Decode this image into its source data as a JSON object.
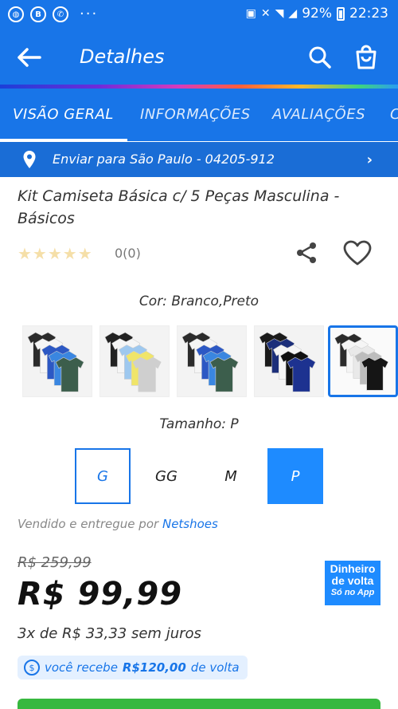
{
  "status_bar": {
    "left_icons": [
      "notification-icon",
      "b-icon",
      "whatsapp-icon"
    ],
    "more": "···",
    "battery_pct": "92%",
    "time": "22:23"
  },
  "app_bar": {
    "title": "Detalhes"
  },
  "tabs": [
    {
      "label": "VISÃO GERAL",
      "active": true
    },
    {
      "label": "INFORMAÇÕES",
      "active": false
    },
    {
      "label": "AVALIAÇÕES",
      "active": false
    },
    {
      "label": "C",
      "active": false
    }
  ],
  "shipping": {
    "text": "Enviar para São Paulo - 04205-912"
  },
  "product": {
    "title": "Kit Camiseta Básica c/ 5 Peças Masculina - Básicos",
    "stars": "★★★★★",
    "rating_count": "0(0)",
    "rating_value": 0
  },
  "color": {
    "label": "Cor: Branco,Preto",
    "swatches": [
      {
        "name": "kit-green-blue",
        "selected": false,
        "shirts": [
          "#2b2b2b",
          "#f5f5f5",
          "#2c58c4",
          "#3a86e0",
          "#3c5e4c"
        ]
      },
      {
        "name": "kit-grey-yellow",
        "selected": false,
        "shirts": [
          "#222222",
          "#f5f5f5",
          "#9ec8ef",
          "#f0e56a",
          "#cfcfcf"
        ]
      },
      {
        "name": "kit-green-navy",
        "selected": false,
        "shirts": [
          "#2b2b2b",
          "#f5f5f5",
          "#2c58c4",
          "#3a86e0",
          "#3c5e4c"
        ]
      },
      {
        "name": "kit-navy-black",
        "selected": false,
        "shirts": [
          "#1a1a1a",
          "#1c2f7a",
          "#f5f5f5",
          "#111111",
          "#1d3290"
        ]
      },
      {
        "name": "kit-white-black",
        "selected": true,
        "shirts": [
          "#2b2b2b",
          "#f5f5f5",
          "#e9e9e9",
          "#bdbdbd",
          "#151515"
        ]
      }
    ]
  },
  "size": {
    "label": "Tamanho: P",
    "options": [
      {
        "label": "G",
        "style": "outlined"
      },
      {
        "label": "GG",
        "style": "plain"
      },
      {
        "label": "M",
        "style": "plain"
      },
      {
        "label": "P",
        "style": "filled"
      }
    ]
  },
  "seller": {
    "prefix": "Vendido e entregue por",
    "name": "Netshoes"
  },
  "pricing": {
    "old_price": "R$ 259,99",
    "price": "R$ 99,99",
    "installments": "3x de R$ 33,33 sem juros",
    "cashback_prefix": "você recebe",
    "cashback_amount": "R$120,00",
    "cashback_suffix": "de volta"
  },
  "badge": {
    "line1": "Dinheiro",
    "line2": "de volta",
    "line3": "Só no App"
  },
  "colors": {
    "primary": "#1875e8",
    "accent": "#1e8bff",
    "buy": "#37b83f"
  }
}
